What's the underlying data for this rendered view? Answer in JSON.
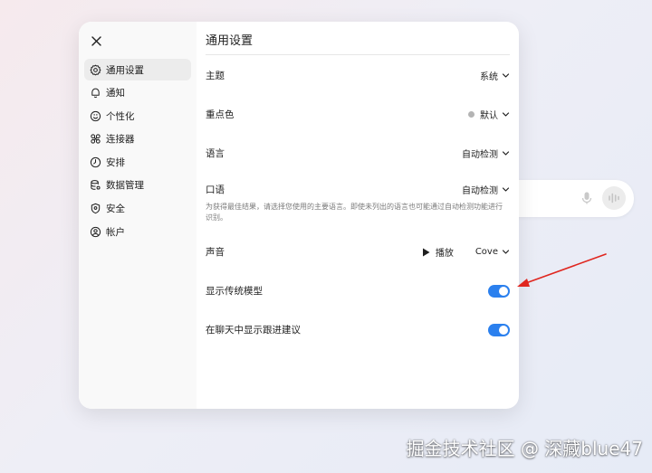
{
  "sidebar": {
    "items": [
      {
        "label": "通用设置",
        "icon": "gear-icon",
        "active": true
      },
      {
        "label": "通知",
        "icon": "bell-icon"
      },
      {
        "label": "个性化",
        "icon": "personalize-icon"
      },
      {
        "label": "连接器",
        "icon": "connector-icon"
      },
      {
        "label": "安排",
        "icon": "clock-icon"
      },
      {
        "label": "数据管理",
        "icon": "database-icon"
      },
      {
        "label": "安全",
        "icon": "shield-icon"
      },
      {
        "label": "帐户",
        "icon": "account-icon"
      }
    ]
  },
  "settings": {
    "title": "通用设置",
    "theme": {
      "label": "主题",
      "value": "系统"
    },
    "accent": {
      "label": "重点色",
      "value": "默认",
      "color": "#b4b4b4"
    },
    "language": {
      "label": "语言",
      "value": "自动检测"
    },
    "spoken_language": {
      "label": "口语",
      "value": "自动检测",
      "help": "为获得最佳结果，请选择您使用的主要语言。即使未列出的语言也可能通过自动检测功能进行识别。"
    },
    "voice": {
      "label": "声音",
      "play_label": "播放",
      "value": "Cove"
    },
    "show_legacy_models": {
      "label": "显示传统模型",
      "enabled": true
    },
    "show_followups": {
      "label": "在聊天中显示跟进建议",
      "enabled": true
    }
  },
  "colors": {
    "toggle_on": "#2b80ee",
    "annotation_arrow": "#e0261f"
  },
  "watermark": "掘金技术社区 @ 深藏blue47"
}
